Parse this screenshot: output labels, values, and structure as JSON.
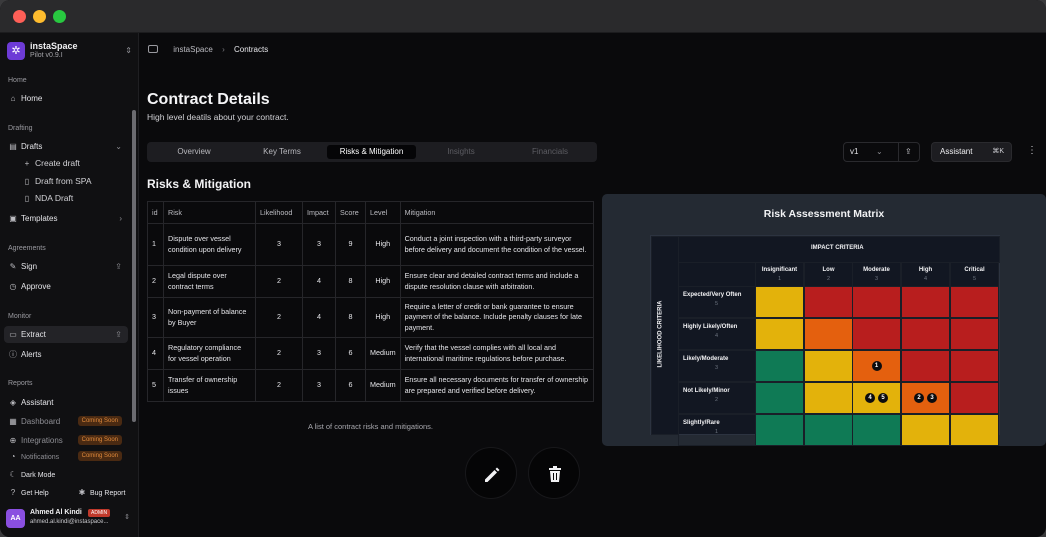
{
  "brand": {
    "name": "instaSpace",
    "version": "Pilot v0.9.I",
    "chevron": "⇕"
  },
  "sidebar": {
    "home_section": "Home",
    "home": "Home",
    "drafting_section": "Drafting",
    "drafts": "Drafts",
    "create_draft": "Create draft",
    "draft_from_spa": "Draft from SPA",
    "nda_draft": "NDA Draft",
    "templates": "Templates",
    "agreements_section": "Agreements",
    "sign": "Sign",
    "approve": "Approve",
    "monitor_section": "Monitor",
    "extract": "Extract",
    "alerts": "Alerts",
    "reports_section": "Reports",
    "assistant": "Assistant",
    "dashboard": "Dashboard",
    "integrations": "Integrations",
    "notifications": "Notifications",
    "coming_soon": "Coming Soon",
    "dark_mode": "Dark Mode",
    "get_help": "Get Help",
    "bug_report": "Bug Report"
  },
  "user": {
    "initials": "AA",
    "name": "Ahmed Al Kindi",
    "role": "ADMIN",
    "email": "ahmed.al.kindi@instaspace..."
  },
  "breadcrumb": {
    "root": "instaSpace",
    "current": "Contracts"
  },
  "page": {
    "title": "Contract Details",
    "subtitle": "High level deatils about your contract."
  },
  "tabs": [
    "Overview",
    "Key Terms",
    "Risks & Mitigation",
    "Insights",
    "Financials"
  ],
  "version": {
    "value": "v1"
  },
  "assistant": {
    "label": "Assistant",
    "shortcut": "⌘K"
  },
  "section_title": "Risks & Mitigation",
  "table": {
    "headers": [
      "id",
      "Risk",
      "Likelihood",
      "Impact",
      "Score",
      "Level",
      "Mitigation"
    ],
    "rows": [
      [
        "1",
        "Dispute over vessel condition upon delivery",
        "3",
        "3",
        "9",
        "High",
        "Conduct a joint inspection with a third-party surveyor before delivery and document the condition of the vessel."
      ],
      [
        "2",
        "Legal dispute over contract terms",
        "2",
        "4",
        "8",
        "High",
        "Ensure clear and detailed contract terms and include a dispute resolution clause with arbitration."
      ],
      [
        "3",
        "Non-payment of balance by Buyer",
        "2",
        "4",
        "8",
        "High",
        "Require a letter of credit or bank guarantee to ensure payment of the balance. Include penalty clauses for late payment."
      ],
      [
        "4",
        "Regulatory compliance for vessel operation",
        "2",
        "3",
        "6",
        "Medium",
        "Verify that the vessel complies with all local and international maritime regulations before purchase."
      ],
      [
        "5",
        "Transfer of ownership issues",
        "2",
        "3",
        "6",
        "Medium",
        "Ensure all necessary documents for transfer of ownership are prepared and verified before delivery."
      ]
    ],
    "caption": "A list of contract risks and mitigations."
  },
  "matrix": {
    "title": "Risk Assessment Matrix",
    "impact_label": "IMPACT CRITERIA",
    "likelihood_label": "LIKELIHOOD CRITERIA",
    "impact": [
      {
        "name": "Insignificant",
        "n": "1"
      },
      {
        "name": "Low",
        "n": "2"
      },
      {
        "name": "Moderate",
        "n": "3"
      },
      {
        "name": "High",
        "n": "4"
      },
      {
        "name": "Critical",
        "n": "5"
      }
    ],
    "likelihood": [
      {
        "name": "Expected/Very Often",
        "n": "5"
      },
      {
        "name": "Highly Likely/Often",
        "n": "4"
      },
      {
        "name": "Likely/Moderate",
        "n": "3"
      },
      {
        "name": "Not Likely/Minor",
        "n": "2"
      },
      {
        "name": "Slightly/Rare",
        "n": "1"
      }
    ],
    "colors": {
      "green": "#0f7a55",
      "yellow": "#e3b20b",
      "orange": "#e4600e",
      "red": "#b81e1e"
    },
    "cells": [
      [
        "yellow",
        "red",
        "red",
        "red",
        "red"
      ],
      [
        "yellow",
        "orange",
        "red",
        "red",
        "red"
      ],
      [
        "green",
        "yellow",
        "orange",
        "red",
        "red"
      ],
      [
        "green",
        "yellow",
        "yellow",
        "orange",
        "red"
      ],
      [
        "green",
        "green",
        "green",
        "yellow",
        "yellow"
      ]
    ],
    "markers": [
      {
        "row": 2,
        "col": 2,
        "ids": [
          "1"
        ]
      },
      {
        "row": 3,
        "col": 2,
        "ids": [
          "4",
          "5"
        ]
      },
      {
        "row": 3,
        "col": 3,
        "ids": [
          "2",
          "3"
        ]
      }
    ]
  }
}
